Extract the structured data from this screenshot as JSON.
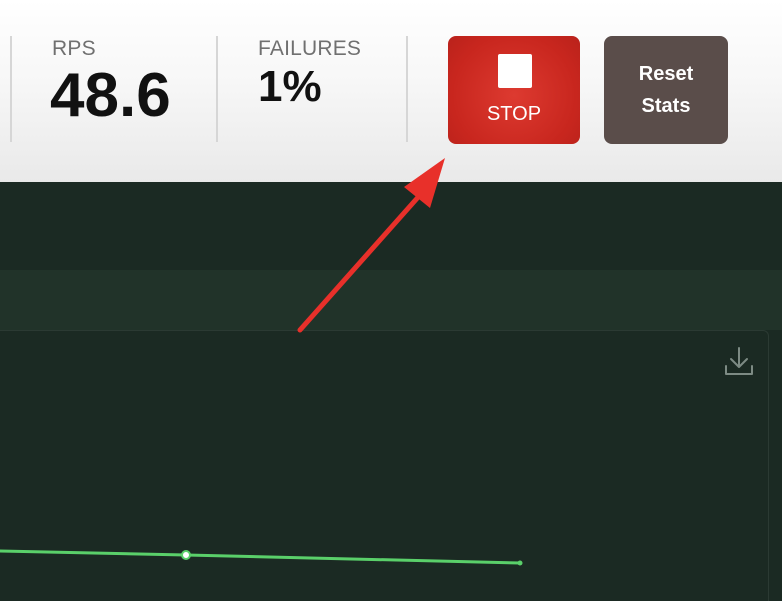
{
  "stats": {
    "rps": {
      "label": "RPS",
      "value": "48.6"
    },
    "failures": {
      "label": "FAILURES",
      "value": "1%"
    }
  },
  "controls": {
    "stop_label": "STOP",
    "reset_label_line1": "Reset",
    "reset_label_line2": "Stats"
  },
  "chart": {
    "line_color": "#5ad06a",
    "icons": [
      "download-icon"
    ]
  },
  "annotation": {
    "arrow_color": "#e8302a"
  },
  "colors": {
    "stop": "#c8261e",
    "reset": "#5a4d4a",
    "dark_bg": "#1b2a23"
  }
}
